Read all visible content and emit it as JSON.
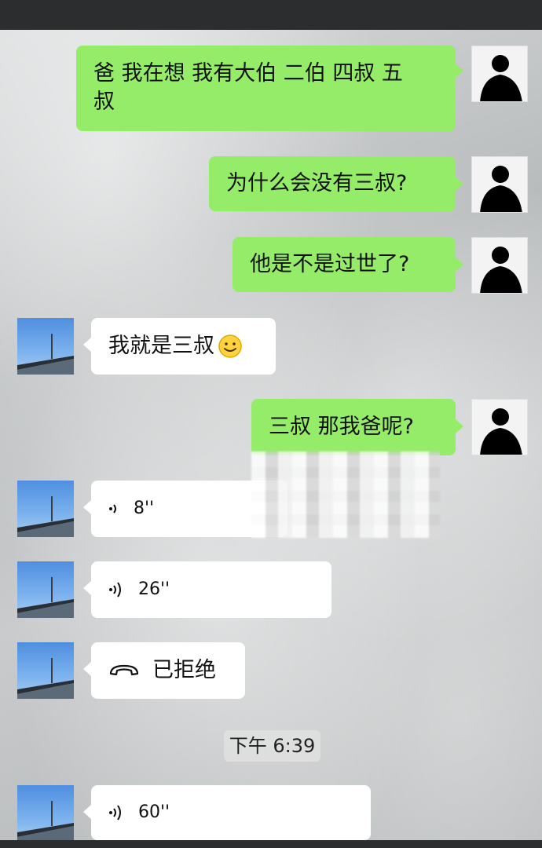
{
  "messages": {
    "m1": {
      "line1": "爸 我在想 我有大伯 二伯 四叔 五",
      "line2": "叔"
    },
    "m2": {
      "text": "为什么会没有三叔?"
    },
    "m3": {
      "text": "他是不是过世了?"
    },
    "m4": {
      "text": "我就是三叔",
      "emoji": "smiley-emoji"
    },
    "m5": {
      "text": "三叔 那我爸呢?"
    },
    "v1": {
      "duration": "8''"
    },
    "v2": {
      "duration": "26''"
    },
    "call": {
      "label": "已拒绝"
    },
    "time": {
      "text": "下午 6:39"
    },
    "v3": {
      "duration": "60''"
    }
  },
  "colors": {
    "sent_bubble": "#95ec69",
    "received_bubble": "#ffffff"
  },
  "icons": {
    "voice": "voice-wave-icon",
    "call": "phone-hangup-icon",
    "avatar_me": "silhouette-avatar",
    "avatar_other": "sky-bridge-avatar"
  }
}
